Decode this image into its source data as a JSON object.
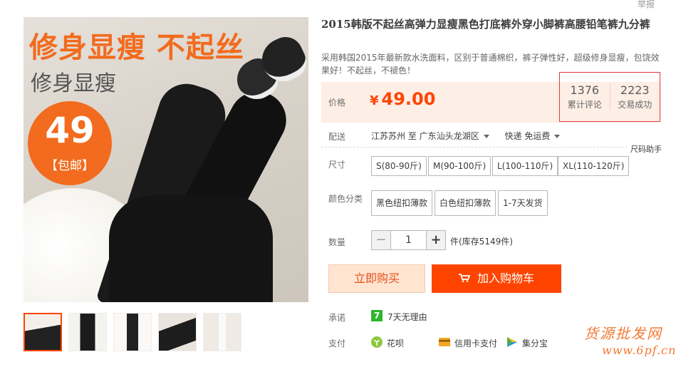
{
  "report_link": "举报",
  "main_image": {
    "headline": "修身显瘦 不起丝",
    "subline": "修身显瘦",
    "badge_number": "49",
    "badge_text": "【包邮】"
  },
  "thumbnails": [
    "thumb-1",
    "thumb-2",
    "thumb-3",
    "thumb-4",
    "thumb-5"
  ],
  "product": {
    "title": "2015韩版不起丝高弹力显瘦黑色打底裤外穿小脚裤高腰铅笔裤九分裤",
    "subtitle": "采用韩国2015年最新款水洗面料，区别于普通棉织，裤子弹性好，超级修身显瘦，包饶效果好！不起丝，不褪色！"
  },
  "price": {
    "label": "价格",
    "currency": "¥",
    "value": "49.00"
  },
  "stats": {
    "reviews_count": "1376",
    "reviews_label": "累计评论",
    "sales_count": "2223",
    "sales_label": "交易成功"
  },
  "shipping": {
    "label": "配送",
    "from": "江苏苏州 至",
    "to": "广东汕头龙湖区",
    "method": "快递 免运费"
  },
  "size_help": "尺码助手",
  "size": {
    "label": "尺寸",
    "options": [
      "S(80-90斤)",
      "M(90-100斤)",
      "L(100-110斤)",
      "XL(110-120斤)"
    ]
  },
  "color": {
    "label": "颜色分类",
    "options": [
      "黑色纽扣薄款",
      "白色纽扣薄款",
      "1-7天发货"
    ]
  },
  "quantity": {
    "label": "数量",
    "minus": "−",
    "plus": "+",
    "value": "1",
    "stock_text": "件(库存5149件)"
  },
  "actions": {
    "buy_now": "立即购买",
    "add_to_cart": "加入购物车"
  },
  "promise": {
    "label": "承诺",
    "icon_text": "7",
    "text": "7天无理由"
  },
  "payment": {
    "label": "支付",
    "methods": [
      "花呗",
      "信用卡支付",
      "集分宝"
    ]
  },
  "watermark": {
    "line1": "货源批发网",
    "line2": "www.6pf.cn"
  },
  "colors": {
    "accent": "#ff4400",
    "price": "#ff4400",
    "price_bg": "#fdeee6",
    "highlight_border": "#e4393c",
    "promise_green": "#2db62d"
  }
}
